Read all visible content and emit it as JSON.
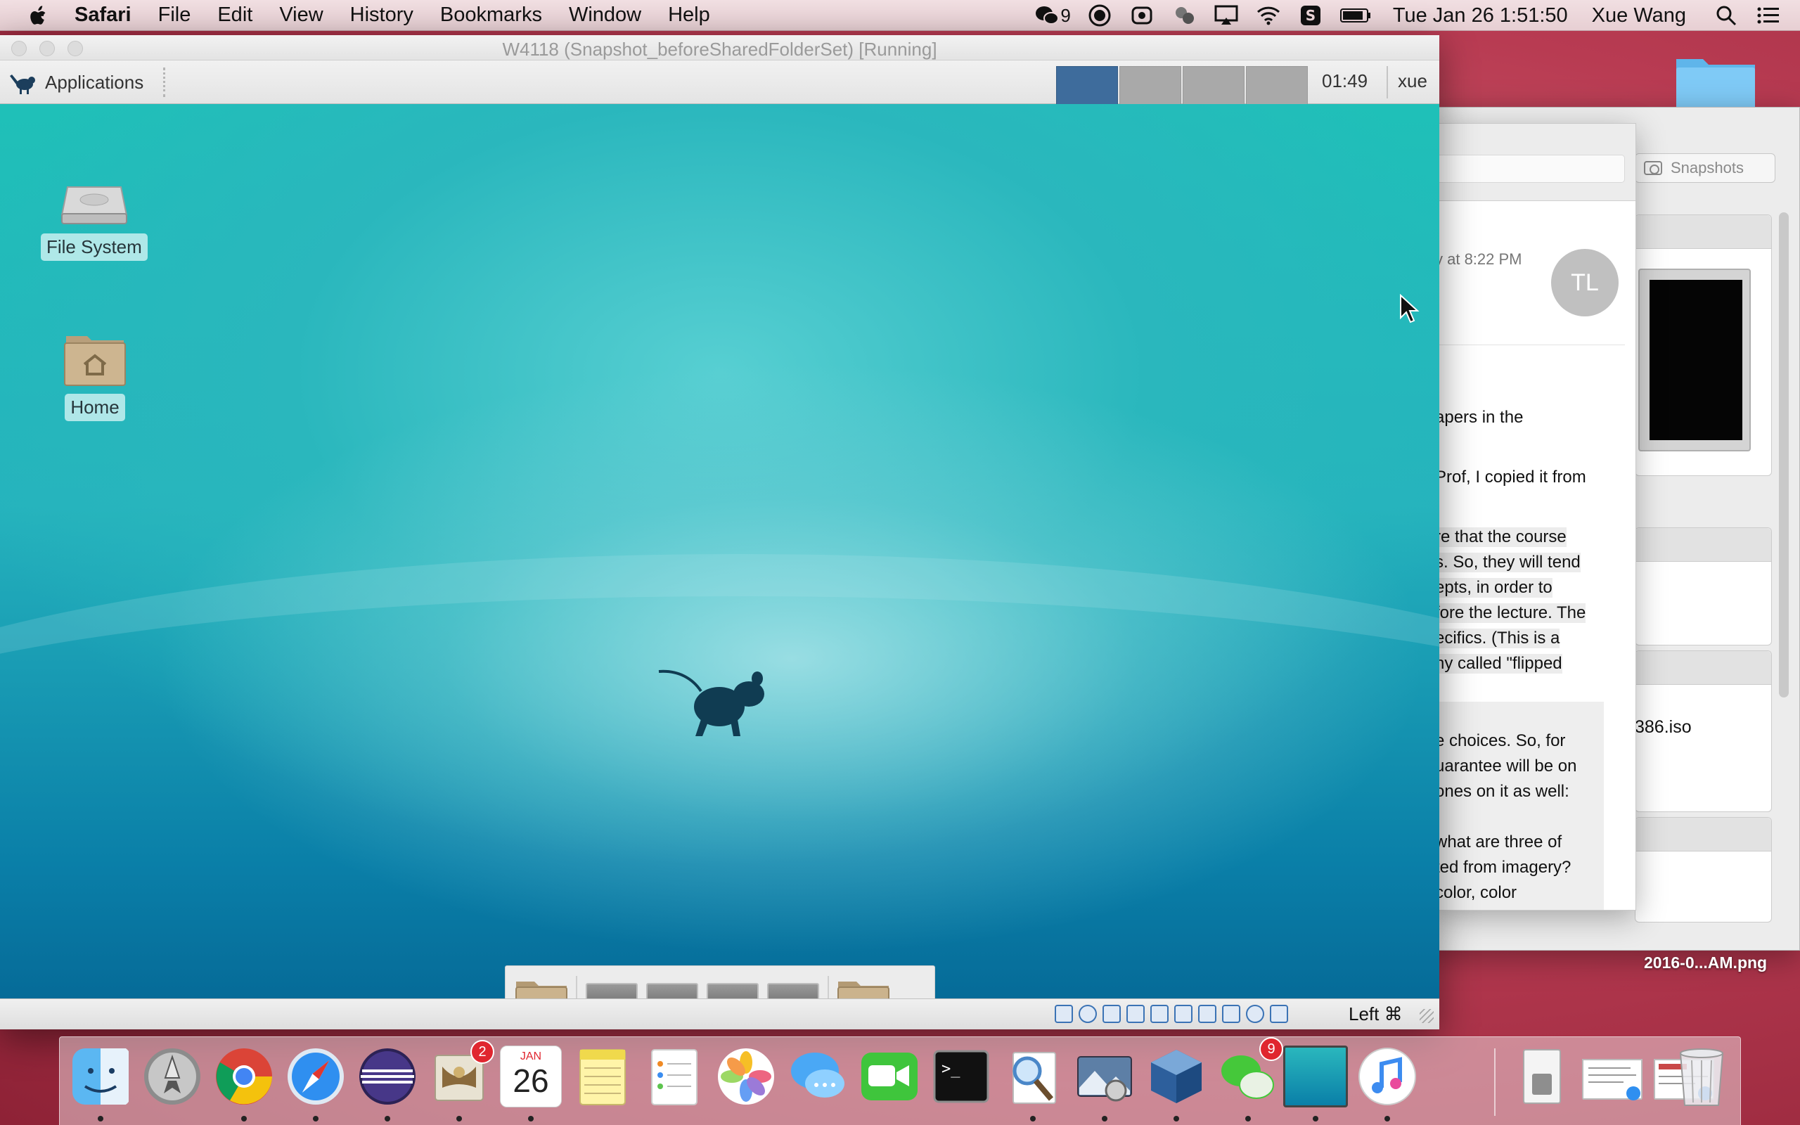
{
  "menubar": {
    "app_name": "Safari",
    "items": [
      "File",
      "Edit",
      "View",
      "History",
      "Bookmarks",
      "Window",
      "Help"
    ],
    "wechat_count": "9",
    "clock": "Tue Jan 26  1:51:50",
    "user": "Xue Wang"
  },
  "vm_window": {
    "title": "W4118 (Snapshot_beforeSharedFolderSet) [Running]",
    "host_key": "Left ⌘"
  },
  "guest_panel": {
    "applications_label": "Applications",
    "clock": "01:49",
    "user": "xue",
    "workspaces": 4,
    "active_workspace": 1
  },
  "guest_desktop": {
    "icons": [
      {
        "label": "File System"
      },
      {
        "label": "Home"
      }
    ]
  },
  "vbox_manager": {
    "snapshots_label": "Snapshots",
    "iso_text": "386.iso"
  },
  "mail": {
    "date": "y at 8:22 PM",
    "avatar_initials": "TL",
    "lines": [
      "apers in the",
      "Prof, I copied it from",
      "re that the course",
      "s.  So, they will tend",
      "epts, in order to",
      "fore the lecture. The",
      "ecifics.  (This is a",
      "ny called \"flipped",
      "e choices.  So, for",
      "uarantee will be on",
      " ones on it as well:",
      " what are three of",
      "ted from imagery?",
      " color, color"
    ]
  },
  "desktop_file": {
    "label": "2016-0...AM.png"
  },
  "dock": {
    "mail_badge": "2",
    "calendar_month": "JAN",
    "calendar_day": "26",
    "wechat_badge": "9"
  },
  "colors": {
    "guest_teal": "#25b3bd",
    "workspace_active": "#3e6c9c",
    "badge_red": "#e0262f"
  }
}
